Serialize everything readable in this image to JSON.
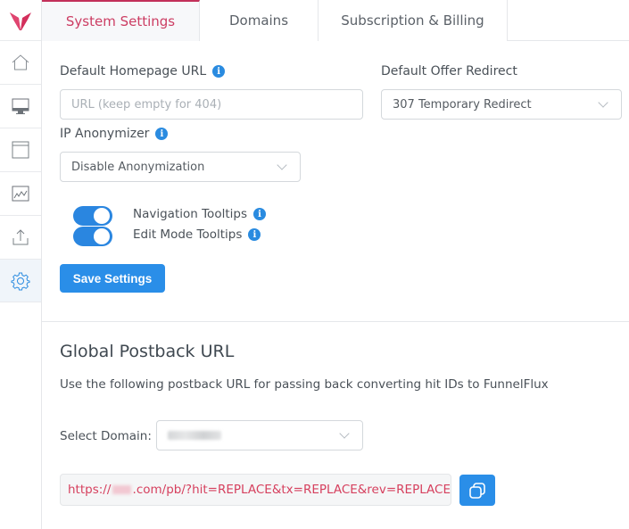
{
  "sidebar": {
    "logo": "brand-logo",
    "items": [
      {
        "name": "home",
        "icon": "home-icon"
      },
      {
        "name": "monitor",
        "icon": "monitor-icon"
      },
      {
        "name": "browser",
        "icon": "window-icon"
      },
      {
        "name": "reports",
        "icon": "chart-icon"
      },
      {
        "name": "upload",
        "icon": "upload-icon"
      },
      {
        "name": "settings",
        "icon": "gear-icon",
        "active": true
      }
    ]
  },
  "tabs": [
    {
      "label": "System Settings",
      "active": true
    },
    {
      "label": "Domains"
    },
    {
      "label": "Subscription & Billing"
    }
  ],
  "system_settings": {
    "homepage_label": "Default Homepage URL",
    "homepage_placeholder": "URL (keep empty for 404)",
    "homepage_value": "",
    "redirect_label": "Default Offer Redirect",
    "redirect_value": "307 Temporary Redirect",
    "anonymizer_label": "IP Anonymizer",
    "anonymizer_value": "Disable Anonymization",
    "toggles": [
      {
        "label": "Navigation Tooltips",
        "on": true
      },
      {
        "label": "Edit Mode Tooltips",
        "on": true
      }
    ],
    "save_label": "Save Settings"
  },
  "postback": {
    "title": "Global Postback URL",
    "description": "Use the following postback URL for passing back converting hit IDs to FunnelFlux",
    "domain_label": "Select Domain:",
    "domain_value": "[blurred]",
    "url_prefix": "https://",
    "url_suffix": ".com/pb/?hit=REPLACE&tx=REPLACE&rev=REPLACE",
    "copy_icon": "copy-icon"
  },
  "colors": {
    "accent": "#c2305a",
    "primary": "#2a8ee8",
    "url_text": "#d6405e"
  }
}
